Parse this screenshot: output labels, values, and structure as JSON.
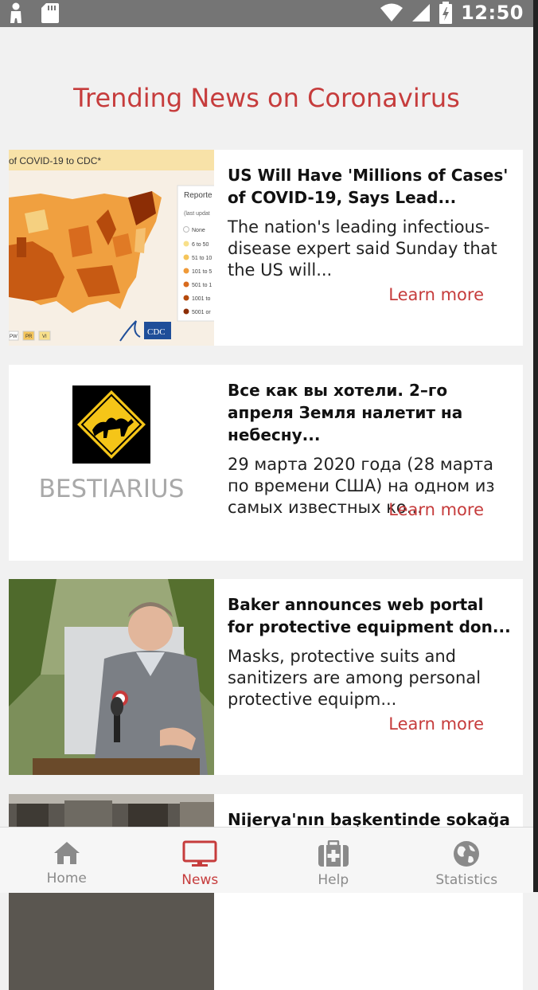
{
  "status_bar": {
    "time": "12:50",
    "icons": [
      "person-icon",
      "sd-card-icon",
      "wifi-icon",
      "signal-icon",
      "battery-icon"
    ]
  },
  "page": {
    "title": "Trending News on Coronavirus"
  },
  "articles": [
    {
      "title": "US Will Have 'Millions of Cases' of COVID-19, Says Lead...",
      "description": "The nation's leading infectious-disease expert said Sunday that the US will...",
      "learn_more": "Learn more",
      "image": {
        "header": "of COVID-19 to CDC*",
        "legend_title": "Reporte",
        "legend_sub": "(last updat",
        "legend": [
          "None",
          "6 to 50",
          "51 to 10",
          "101 to 5",
          "501 to 1",
          "1001 to",
          "5001 or"
        ],
        "territories": [
          "PW",
          "PR",
          "VI"
        ],
        "logo": "CDC"
      }
    },
    {
      "title": "Все как вы хотели. 2–го апреля Земля налетит на небесну...",
      "description": "29 марта 2020 года (28 марта по времени США) на одном из самых известных ко...",
      "learn_more": "Learn more",
      "image": {
        "brand": "BESTIARIUS"
      }
    },
    {
      "title": "Baker announces web portal for protective equipment don...",
      "description": "Masks, protective suits and sanitizers are among personal protective equipm...",
      "learn_more": "Learn more",
      "image": {}
    },
    {
      "title": "Nijerya'nın başkentinde sokağa",
      "description": "",
      "learn_more": "",
      "image": {}
    }
  ],
  "bottom_nav": {
    "active": "News",
    "items": [
      {
        "label": "Home",
        "icon": "home-icon"
      },
      {
        "label": "News",
        "icon": "monitor-icon"
      },
      {
        "label": "Help",
        "icon": "medkit-icon"
      },
      {
        "label": "Statistics",
        "icon": "globe-icon"
      }
    ]
  },
  "colors": {
    "accent": "#c63c3c",
    "status_bar": "#757575",
    "background": "#f1f1f1",
    "nav_inactive": "#8a8a8a"
  }
}
